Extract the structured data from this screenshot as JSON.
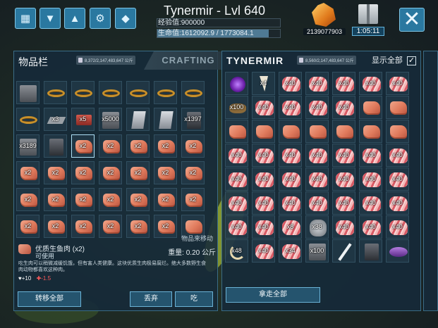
{
  "header": {
    "player_name": "Tynermir - Lvl 640",
    "xp_text": "经验值:900000",
    "hp_text": "生命值:1612092.9 / 1773084.1",
    "hp_fraction": 0.909,
    "currency": "2139077903",
    "timer": "1:05:11",
    "toolbar_icons": [
      "backpack-icon",
      "footprint-icon",
      "dino-herd-icon",
      "engram-icon",
      "crystal-icon"
    ]
  },
  "left_panel": {
    "title": "物品栏",
    "crafting_tab": "CRAFTING",
    "weight_readout": "8,372/2,147,483,647 公斤",
    "drag_hint": "物品来移动",
    "slots": [
      {
        "icon": "gear",
        "qty": ""
      },
      {
        "icon": "ring",
        "qty": ""
      },
      {
        "icon": "ring",
        "qty": ""
      },
      {
        "icon": "ring",
        "qty": ""
      },
      {
        "icon": "ring",
        "qty": ""
      },
      {
        "icon": "ring",
        "qty": ""
      },
      {
        "icon": "ring",
        "qty": ""
      },
      {
        "icon": "ring",
        "qty": ""
      },
      {
        "icon": "plate",
        "qty": "x3"
      },
      {
        "icon": "brick",
        "qty": "x5"
      },
      {
        "icon": "gear",
        "qty": "x5000"
      },
      {
        "icon": "shard",
        "qty": ""
      },
      {
        "icon": "shard",
        "qty": ""
      },
      {
        "icon": "dark",
        "qty": "x1397"
      },
      {
        "icon": "gear",
        "qty": "x3189"
      },
      {
        "icon": "dark",
        "qty": ""
      },
      {
        "icon": "meat",
        "qty": "x2"
      },
      {
        "icon": "meat",
        "qty": "x2"
      },
      {
        "icon": "meat",
        "qty": "x2"
      },
      {
        "icon": "meat",
        "qty": "x2"
      },
      {
        "icon": "meat",
        "qty": "x2"
      },
      {
        "icon": "meat",
        "qty": "x2"
      },
      {
        "icon": "meat",
        "qty": "x2"
      },
      {
        "icon": "meat",
        "qty": "x2"
      },
      {
        "icon": "meat",
        "qty": "x2"
      },
      {
        "icon": "meat",
        "qty": "x2"
      },
      {
        "icon": "meat",
        "qty": "x2"
      },
      {
        "icon": "meat",
        "qty": "x2"
      },
      {
        "icon": "meat",
        "qty": "x2"
      },
      {
        "icon": "meat",
        "qty": "x2"
      },
      {
        "icon": "meat",
        "qty": "x2"
      },
      {
        "icon": "meat",
        "qty": "x2"
      },
      {
        "icon": "meat",
        "qty": "x2"
      },
      {
        "icon": "meat",
        "qty": "x2"
      },
      {
        "icon": "meat",
        "qty": "x2"
      },
      {
        "icon": "meat",
        "qty": "x2"
      },
      {
        "icon": "meat",
        "qty": "x2"
      },
      {
        "icon": "meat",
        "qty": "x2"
      },
      {
        "icon": "meat",
        "qty": "x2"
      },
      {
        "icon": "meat",
        "qty": "x2"
      },
      {
        "icon": "meat",
        "qty": "x2"
      },
      {
        "icon": "meat",
        "qty": ""
      }
    ],
    "selected_item": {
      "name": "优质生鱼肉 (x2)",
      "usable": "可使用",
      "weight": "重量: 0.20 公斤",
      "description": "吃生肉可以稍微减缓饥饿，但有害人类健康。这块优质生肉极易腐烂。绝大多数野生食肉动物都喜欢这种肉。",
      "stat_a": "+10",
      "stat_b": "-1.5"
    },
    "buttons": {
      "transfer_all": "转移全部",
      "drop": "丢弃",
      "eat": "吃"
    }
  },
  "right_panel": {
    "title": "TYNERMIR",
    "weight_readout": "8,560/2,147,483,647 公斤",
    "show_all_label": "显示全部",
    "show_all_checked": true,
    "slots": [
      {
        "icon": "orb",
        "qty": ""
      },
      {
        "icon": "tooth",
        "qty": "x4"
      },
      {
        "icon": "rawmeat",
        "qty": "x40"
      },
      {
        "icon": "rawmeat",
        "qty": "x40"
      },
      {
        "icon": "rawmeat",
        "qty": "x40"
      },
      {
        "icon": "rawmeat",
        "qty": "x40"
      },
      {
        "icon": "rawmeat",
        "qty": "x40"
      },
      {
        "icon": "dirt",
        "qty": "x100"
      },
      {
        "icon": "rawmeat",
        "qty": "x40"
      },
      {
        "icon": "rawmeat",
        "qty": "x40"
      },
      {
        "icon": "rawmeat",
        "qty": "x40"
      },
      {
        "icon": "rawmeat",
        "qty": "x40"
      },
      {
        "icon": "meat",
        "qty": ""
      },
      {
        "icon": "meat",
        "qty": ""
      },
      {
        "icon": "meat",
        "qty": ""
      },
      {
        "icon": "meat",
        "qty": ""
      },
      {
        "icon": "meat",
        "qty": ""
      },
      {
        "icon": "meat",
        "qty": ""
      },
      {
        "icon": "meat",
        "qty": ""
      },
      {
        "icon": "meat",
        "qty": ""
      },
      {
        "icon": "meat",
        "qty": ""
      },
      {
        "icon": "rawmeat",
        "qty": "x40"
      },
      {
        "icon": "rawmeat",
        "qty": "x40"
      },
      {
        "icon": "rawmeat",
        "qty": "x40"
      },
      {
        "icon": "rawmeat",
        "qty": "x40"
      },
      {
        "icon": "rawmeat",
        "qty": "x40"
      },
      {
        "icon": "rawmeat",
        "qty": "x40"
      },
      {
        "icon": "rawmeat",
        "qty": "x40"
      },
      {
        "icon": "rawmeat",
        "qty": "x40"
      },
      {
        "icon": "rawmeat",
        "qty": "x40"
      },
      {
        "icon": "rawmeat",
        "qty": "x40"
      },
      {
        "icon": "rawmeat",
        "qty": "x40"
      },
      {
        "icon": "rawmeat",
        "qty": "x40"
      },
      {
        "icon": "rawmeat",
        "qty": "x40"
      },
      {
        "icon": "rawmeat",
        "qty": "x40"
      },
      {
        "icon": "rawmeat",
        "qty": "x40"
      },
      {
        "icon": "rawmeat",
        "qty": "x40"
      },
      {
        "icon": "rawmeat",
        "qty": "x40"
      },
      {
        "icon": "rawmeat",
        "qty": "x40"
      },
      {
        "icon": "rawmeat",
        "qty": "x40"
      },
      {
        "icon": "rawmeat",
        "qty": "x40"
      },
      {
        "icon": "rawmeat",
        "qty": "x40"
      },
      {
        "icon": "rawmeat",
        "qty": "x40"
      },
      {
        "icon": "rawmeat",
        "qty": "x40"
      },
      {
        "icon": "rawmeat",
        "qty": "x8"
      },
      {
        "icon": "stone",
        "qty": "x38"
      },
      {
        "icon": "rawmeat",
        "qty": "x40"
      },
      {
        "icon": "rawmeat",
        "qty": "x40"
      },
      {
        "icon": "rawmeat",
        "qty": "x40"
      },
      {
        "icon": "horn",
        "qty": "x48"
      },
      {
        "icon": "rawmeat",
        "qty": "x40"
      },
      {
        "icon": "rawmeat",
        "qty": "x34"
      },
      {
        "icon": "gear",
        "qty": "x100"
      },
      {
        "icon": "sword",
        "qty": ""
      },
      {
        "icon": "dark",
        "qty": ""
      },
      {
        "icon": "pouch",
        "qty": ""
      }
    ],
    "buttons": {
      "take_all": "拿走全部"
    }
  }
}
